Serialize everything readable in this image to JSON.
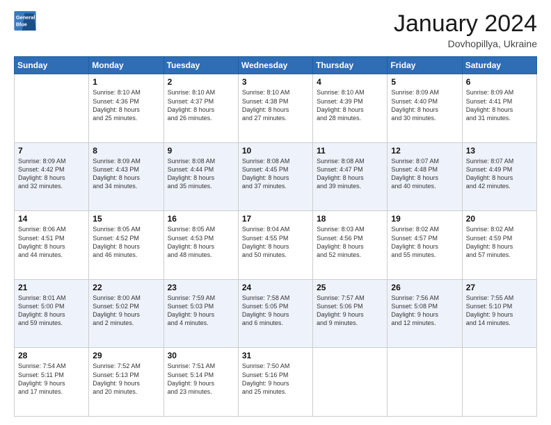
{
  "header": {
    "logo_line1": "General",
    "logo_line2": "Blue",
    "month": "January 2024",
    "location": "Dovhopillya, Ukraine"
  },
  "weekdays": [
    "Sunday",
    "Monday",
    "Tuesday",
    "Wednesday",
    "Thursday",
    "Friday",
    "Saturday"
  ],
  "weeks": [
    [
      {
        "day": "",
        "info": ""
      },
      {
        "day": "1",
        "info": "Sunrise: 8:10 AM\nSunset: 4:36 PM\nDaylight: 8 hours\nand 25 minutes."
      },
      {
        "day": "2",
        "info": "Sunrise: 8:10 AM\nSunset: 4:37 PM\nDaylight: 8 hours\nand 26 minutes."
      },
      {
        "day": "3",
        "info": "Sunrise: 8:10 AM\nSunset: 4:38 PM\nDaylight: 8 hours\nand 27 minutes."
      },
      {
        "day": "4",
        "info": "Sunrise: 8:10 AM\nSunset: 4:39 PM\nDaylight: 8 hours\nand 28 minutes."
      },
      {
        "day": "5",
        "info": "Sunrise: 8:09 AM\nSunset: 4:40 PM\nDaylight: 8 hours\nand 30 minutes."
      },
      {
        "day": "6",
        "info": "Sunrise: 8:09 AM\nSunset: 4:41 PM\nDaylight: 8 hours\nand 31 minutes."
      }
    ],
    [
      {
        "day": "7",
        "info": "Sunrise: 8:09 AM\nSunset: 4:42 PM\nDaylight: 8 hours\nand 32 minutes."
      },
      {
        "day": "8",
        "info": "Sunrise: 8:09 AM\nSunset: 4:43 PM\nDaylight: 8 hours\nand 34 minutes."
      },
      {
        "day": "9",
        "info": "Sunrise: 8:08 AM\nSunset: 4:44 PM\nDaylight: 8 hours\nand 35 minutes."
      },
      {
        "day": "10",
        "info": "Sunrise: 8:08 AM\nSunset: 4:45 PM\nDaylight: 8 hours\nand 37 minutes."
      },
      {
        "day": "11",
        "info": "Sunrise: 8:08 AM\nSunset: 4:47 PM\nDaylight: 8 hours\nand 39 minutes."
      },
      {
        "day": "12",
        "info": "Sunrise: 8:07 AM\nSunset: 4:48 PM\nDaylight: 8 hours\nand 40 minutes."
      },
      {
        "day": "13",
        "info": "Sunrise: 8:07 AM\nSunset: 4:49 PM\nDaylight: 8 hours\nand 42 minutes."
      }
    ],
    [
      {
        "day": "14",
        "info": "Sunrise: 8:06 AM\nSunset: 4:51 PM\nDaylight: 8 hours\nand 44 minutes."
      },
      {
        "day": "15",
        "info": "Sunrise: 8:05 AM\nSunset: 4:52 PM\nDaylight: 8 hours\nand 46 minutes."
      },
      {
        "day": "16",
        "info": "Sunrise: 8:05 AM\nSunset: 4:53 PM\nDaylight: 8 hours\nand 48 minutes."
      },
      {
        "day": "17",
        "info": "Sunrise: 8:04 AM\nSunset: 4:55 PM\nDaylight: 8 hours\nand 50 minutes."
      },
      {
        "day": "18",
        "info": "Sunrise: 8:03 AM\nSunset: 4:56 PM\nDaylight: 8 hours\nand 52 minutes."
      },
      {
        "day": "19",
        "info": "Sunrise: 8:02 AM\nSunset: 4:57 PM\nDaylight: 8 hours\nand 55 minutes."
      },
      {
        "day": "20",
        "info": "Sunrise: 8:02 AM\nSunset: 4:59 PM\nDaylight: 8 hours\nand 57 minutes."
      }
    ],
    [
      {
        "day": "21",
        "info": "Sunrise: 8:01 AM\nSunset: 5:00 PM\nDaylight: 8 hours\nand 59 minutes."
      },
      {
        "day": "22",
        "info": "Sunrise: 8:00 AM\nSunset: 5:02 PM\nDaylight: 9 hours\nand 2 minutes."
      },
      {
        "day": "23",
        "info": "Sunrise: 7:59 AM\nSunset: 5:03 PM\nDaylight: 9 hours\nand 4 minutes."
      },
      {
        "day": "24",
        "info": "Sunrise: 7:58 AM\nSunset: 5:05 PM\nDaylight: 9 hours\nand 6 minutes."
      },
      {
        "day": "25",
        "info": "Sunrise: 7:57 AM\nSunset: 5:06 PM\nDaylight: 9 hours\nand 9 minutes."
      },
      {
        "day": "26",
        "info": "Sunrise: 7:56 AM\nSunset: 5:08 PM\nDaylight: 9 hours\nand 12 minutes."
      },
      {
        "day": "27",
        "info": "Sunrise: 7:55 AM\nSunset: 5:10 PM\nDaylight: 9 hours\nand 14 minutes."
      }
    ],
    [
      {
        "day": "28",
        "info": "Sunrise: 7:54 AM\nSunset: 5:11 PM\nDaylight: 9 hours\nand 17 minutes."
      },
      {
        "day": "29",
        "info": "Sunrise: 7:52 AM\nSunset: 5:13 PM\nDaylight: 9 hours\nand 20 minutes."
      },
      {
        "day": "30",
        "info": "Sunrise: 7:51 AM\nSunset: 5:14 PM\nDaylight: 9 hours\nand 23 minutes."
      },
      {
        "day": "31",
        "info": "Sunrise: 7:50 AM\nSunset: 5:16 PM\nDaylight: 9 hours\nand 25 minutes."
      },
      {
        "day": "",
        "info": ""
      },
      {
        "day": "",
        "info": ""
      },
      {
        "day": "",
        "info": ""
      }
    ]
  ]
}
